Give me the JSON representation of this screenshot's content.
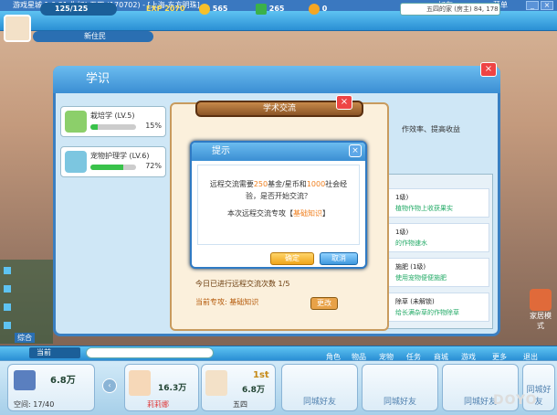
{
  "window": {
    "title": "游戏星城 1.0.31  你好! 五四 (170702) - [上海-东方明珠]",
    "friend": "好友",
    "menu": "菜单"
  },
  "topbar": {
    "hp": "125/125",
    "exp_label": "EXP",
    "exp": "2070",
    "gold": "565",
    "cash": "265",
    "coin": "0",
    "home_label": "五四的家 (房主)",
    "home_coords": "84, 178"
  },
  "player": {
    "rank": "新住民"
  },
  "panel": {
    "title": "学识",
    "skills": [
      {
        "name": "栽培学 (LV.5)",
        "pct": "15%",
        "fill": 0.15
      },
      {
        "name": "宠物护理学 (LV.6)",
        "pct": "72%",
        "fill": 0.72
      }
    ]
  },
  "mid": {
    "header": "学术交流",
    "partial_top": "作效率、提高收益",
    "today_count": "今日已进行远程交流次数 1/5",
    "current": "当前专攻: 基础知识",
    "change": "更改"
  },
  "right_list": [
    {
      "a": "1级)",
      "b": "植物作物上收获果实"
    },
    {
      "a": "1级)",
      "b": "的作物速水"
    },
    {
      "a": "施肥 (1级)",
      "b": "使用宠物便便施肥"
    },
    {
      "a": "除草 (未解锁)",
      "b": "给长满杂草的作物除草"
    }
  ],
  "dialog": {
    "title": "提示",
    "line1a": "远程交流需要",
    "n1": "250",
    "line1b": "基金/星币和",
    "n2": "1000",
    "line1c": "社会经",
    "line2": "验，是否开始交流？",
    "line3a": "本次远程交流专攻【",
    "focus": "基础知识",
    "line3b": "】",
    "ok": "确定",
    "cancel": "取消"
  },
  "bottom_nav": {
    "channel": "当前",
    "items": [
      "角色",
      "物品",
      "宠物",
      "任务",
      "商城",
      "游戏",
      "更多",
      "退出"
    ],
    "side_label": "综合",
    "home_mode": "家居模式"
  },
  "dock": {
    "home_money": "6.8万",
    "home_space": "空间: 17/40",
    "friend1": {
      "money": "16.3万",
      "name": "莉莉娜"
    },
    "self": {
      "rank": "1st",
      "money": "6.8万",
      "name": "五四"
    },
    "empty": [
      "同城好友",
      "同城好友",
      "同城好友",
      "同城好友"
    ]
  },
  "watermark": "DOYO"
}
